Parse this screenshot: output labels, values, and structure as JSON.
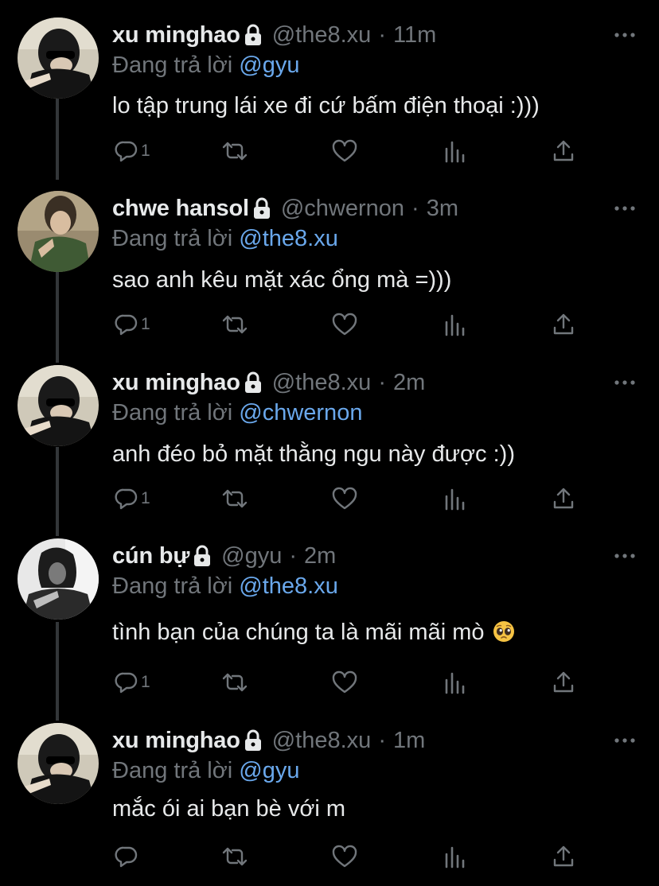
{
  "theme": {
    "background": "#000000",
    "text_primary": "#e7e9ea",
    "text_secondary": "#71767b",
    "link": "#6aa8ec",
    "thread_line": "#333639"
  },
  "tweets": [
    {
      "name": "xu minghao",
      "handle": "@the8.xu",
      "separator": "·",
      "time": "11m",
      "replying_prefix": "Đang trả lời",
      "replying_to": "@gyu",
      "text": "lo tập trung lái xe đi cứ bấm điện thoại :)))",
      "reply_count": "1",
      "avatar": "avatar-minghao"
    },
    {
      "name": "chwe hansol",
      "handle": "@chwernon",
      "separator": "·",
      "time": "3m",
      "replying_prefix": "Đang trả lời",
      "replying_to": "@the8.xu",
      "text": "sao anh kêu mặt xác ổng mà =)))",
      "reply_count": "1",
      "avatar": "avatar-hansol"
    },
    {
      "name": "xu minghao",
      "handle": "@the8.xu",
      "separator": "·",
      "time": "2m",
      "replying_prefix": "Đang trả lời",
      "replying_to": "@chwernon",
      "text": "anh đéo bỏ mặt thằng ngu này được :))",
      "reply_count": "1",
      "avatar": "avatar-minghao"
    },
    {
      "name": "cún bự",
      "handle": "@gyu",
      "separator": "·",
      "time": "2m",
      "replying_prefix": "Đang trả lời",
      "replying_to": "@the8.xu",
      "text": "tình bạn của chúng ta là mãi mãi mò",
      "text_emoji": "pleading-face-emoji",
      "reply_count": "1",
      "avatar": "avatar-gyu"
    },
    {
      "name": "xu minghao",
      "handle": "@the8.xu",
      "separator": "·",
      "time": "1m",
      "replying_prefix": "Đang trả lời",
      "replying_to": "@gyu",
      "text": "mắc ói ai bạn bè với m",
      "reply_count": "",
      "avatar": "avatar-minghao"
    }
  ],
  "icons": {
    "protected": "lock-icon",
    "more": "more-icon",
    "reply": "reply-icon",
    "retweet": "retweet-icon",
    "like": "heart-icon",
    "analytics": "analytics-icon",
    "share": "share-icon"
  }
}
